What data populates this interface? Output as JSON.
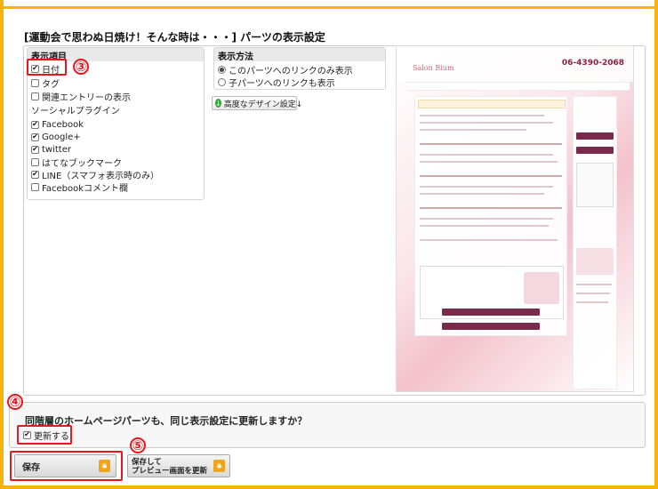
{
  "section": {
    "title": "[運動会で思わぬ日焼け！そんな時は・・・] パーツの表示設定"
  },
  "display_items": {
    "header": "表示項目",
    "items": [
      {
        "label": "日付",
        "checked": true
      },
      {
        "label": "タグ",
        "checked": false
      },
      {
        "label": "関連エントリーの表示",
        "checked": false
      }
    ],
    "social_label": "ソーシャルプラグイン",
    "social": [
      {
        "label": "Facebook",
        "checked": true
      },
      {
        "label": "Google+",
        "checked": true
      },
      {
        "label": "twitter",
        "checked": true
      },
      {
        "label": "はてなブックマーク",
        "checked": false
      },
      {
        "label": "LINE（スマフォ表示時のみ）",
        "checked": true
      },
      {
        "label": "Facebookコメント欄",
        "checked": false
      }
    ]
  },
  "display_method": {
    "header": "表示方法",
    "options": [
      {
        "label": "このパーツへのリンクのみ表示",
        "selected": true
      },
      {
        "label": "子パーツへのリンクも表示",
        "selected": false
      }
    ],
    "advanced_button": "高度なデザイン設定↓"
  },
  "preview": {
    "logo": "Salon Rium",
    "phone": "06-4390-2068"
  },
  "annotations": [
    "③",
    "④",
    "⑤"
  ],
  "footer": {
    "question": "同階層のホームページパーツも、同じ表示設定に更新しますか？",
    "update_label": "更新する",
    "update_checked": true,
    "save_button": "保存",
    "preview_button_line1": "保存して",
    "preview_button_line2": "プレビュー画面を更新"
  },
  "colors": {
    "accent_border": "#f6b30d",
    "highlight": "#e8161d",
    "lock": "#f1a61a"
  }
}
